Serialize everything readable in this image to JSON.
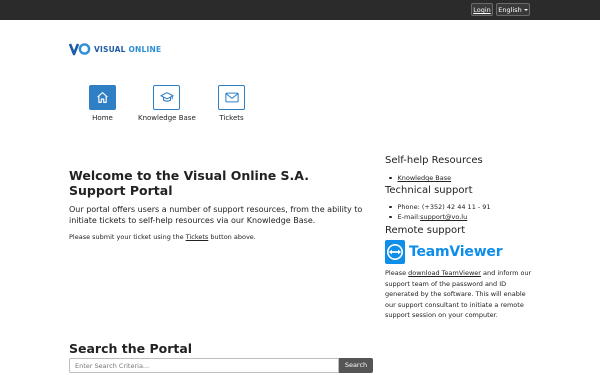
{
  "topbar": {
    "login_label": "Login",
    "language_label": "English"
  },
  "logo": {
    "mark": "VO",
    "text_part1": "VISUAL",
    "text_part2": "ONLINE"
  },
  "nav": {
    "items": [
      {
        "label": "Home",
        "icon": "home-icon",
        "active": true
      },
      {
        "label": "Knowledge Base",
        "icon": "graduation-cap-icon",
        "active": false
      },
      {
        "label": "Tickets",
        "icon": "envelope-icon",
        "active": false
      }
    ]
  },
  "main": {
    "title": "Welcome to the Visual Online S.A. Support Portal",
    "intro": "Our portal offers users a number of support resources, from the ability to initiate tickets to self-help resources via our Knowledge Base.",
    "submit_prefix": "Please submit your ticket using the ",
    "submit_link": "Tickets",
    "submit_suffix": " button above."
  },
  "sidebar": {
    "self_help_title": "Self-help Resources",
    "self_help_items": [
      "Knowledge Base"
    ],
    "tech_support_title": "Technical support",
    "phone_label": "Phone: (+352) 42 44 11 - 91",
    "email_prefix": "E-mail: ",
    "email_link": "support@vo.lu",
    "remote_title": "Remote support",
    "teamviewer_word": "TeamViewer",
    "remote_prefix": "Please ",
    "remote_link": "download TeamViewer",
    "remote_suffix": " and inform our support team of the password and ID generated by the software. This will enable our support consultant to initiate a remote support session on your computer."
  },
  "search": {
    "title": "Search the Portal",
    "placeholder": "Enter Search Criteria...",
    "button_label": "Search"
  },
  "colors": {
    "accent": "#2f7fc5",
    "topbar": "#2b2b2b",
    "teamviewer": "#0e8ee9",
    "logo_dark": "#1d5aa8"
  }
}
